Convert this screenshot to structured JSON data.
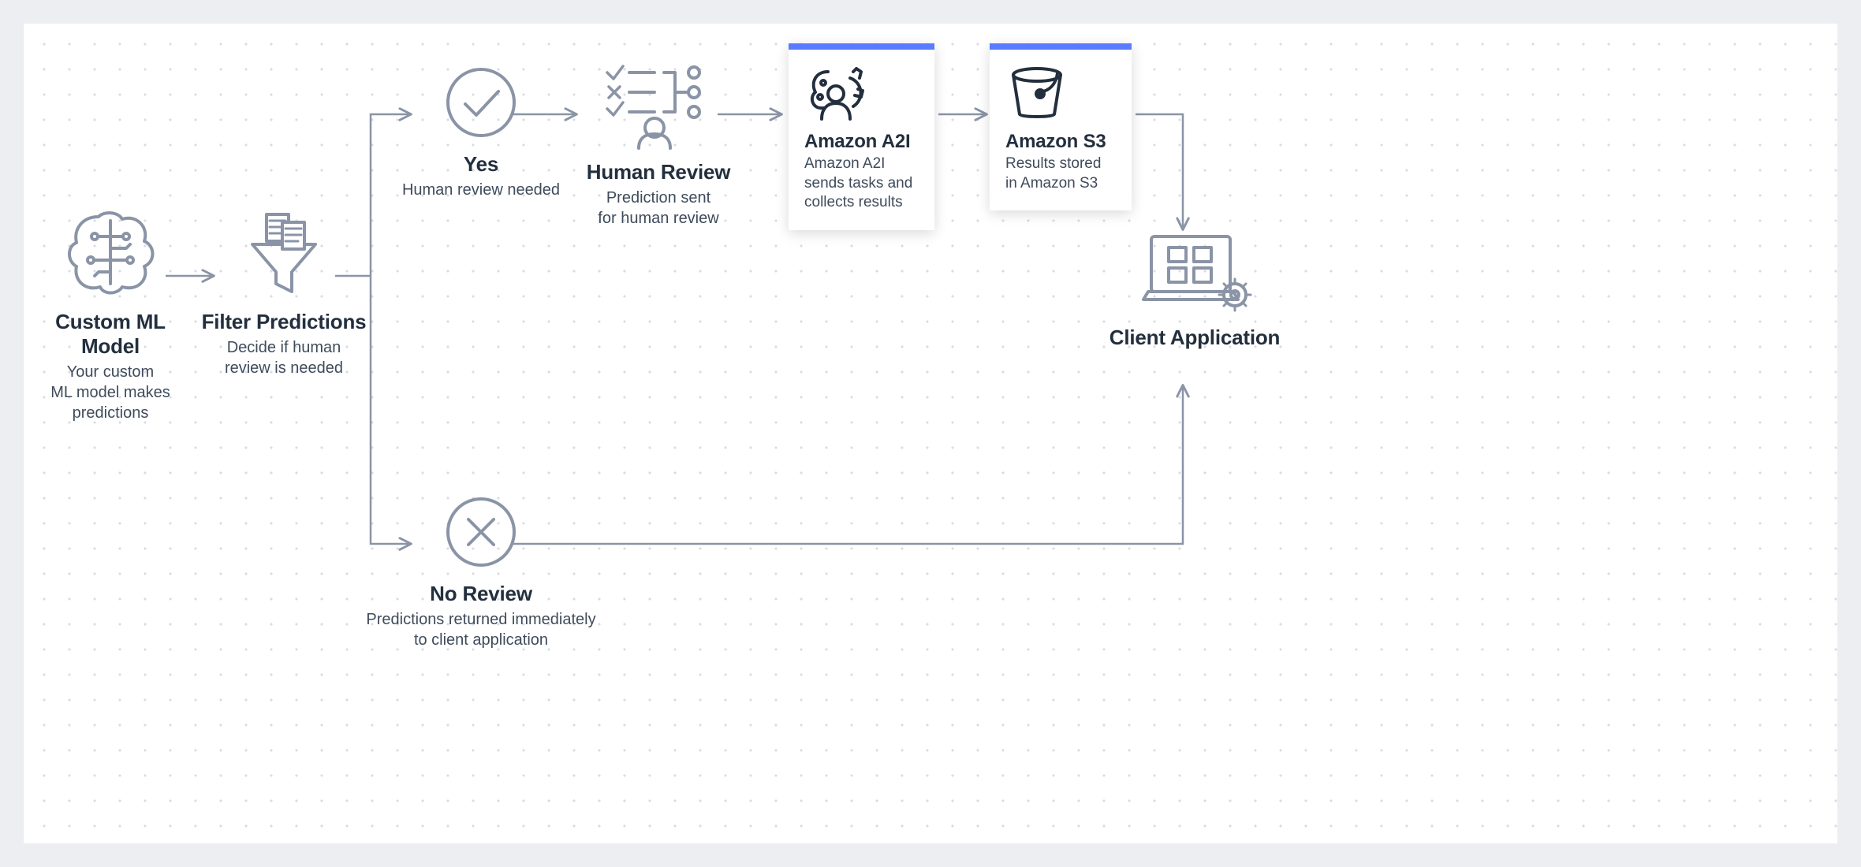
{
  "nodes": {
    "ml_model": {
      "title": "Custom ML Model",
      "desc": "Your custom\nML model makes\npredictions"
    },
    "filter": {
      "title": "Filter Predictions",
      "desc": "Decide if human\nreview is needed"
    },
    "yes": {
      "title": "Yes",
      "desc": "Human review needed"
    },
    "human_review": {
      "title": "Human Review",
      "desc": "Prediction sent\nfor human review"
    },
    "a2i": {
      "title": "Amazon A2I",
      "desc": "Amazon A2I\nsends tasks and\ncollects results"
    },
    "s3": {
      "title": "Amazon S3",
      "desc": "Results stored\nin Amazon S3"
    },
    "client": {
      "title": "Client Application",
      "desc": ""
    },
    "no_review": {
      "title": "No Review",
      "desc": "Predictions returned immediately\nto client application"
    }
  }
}
